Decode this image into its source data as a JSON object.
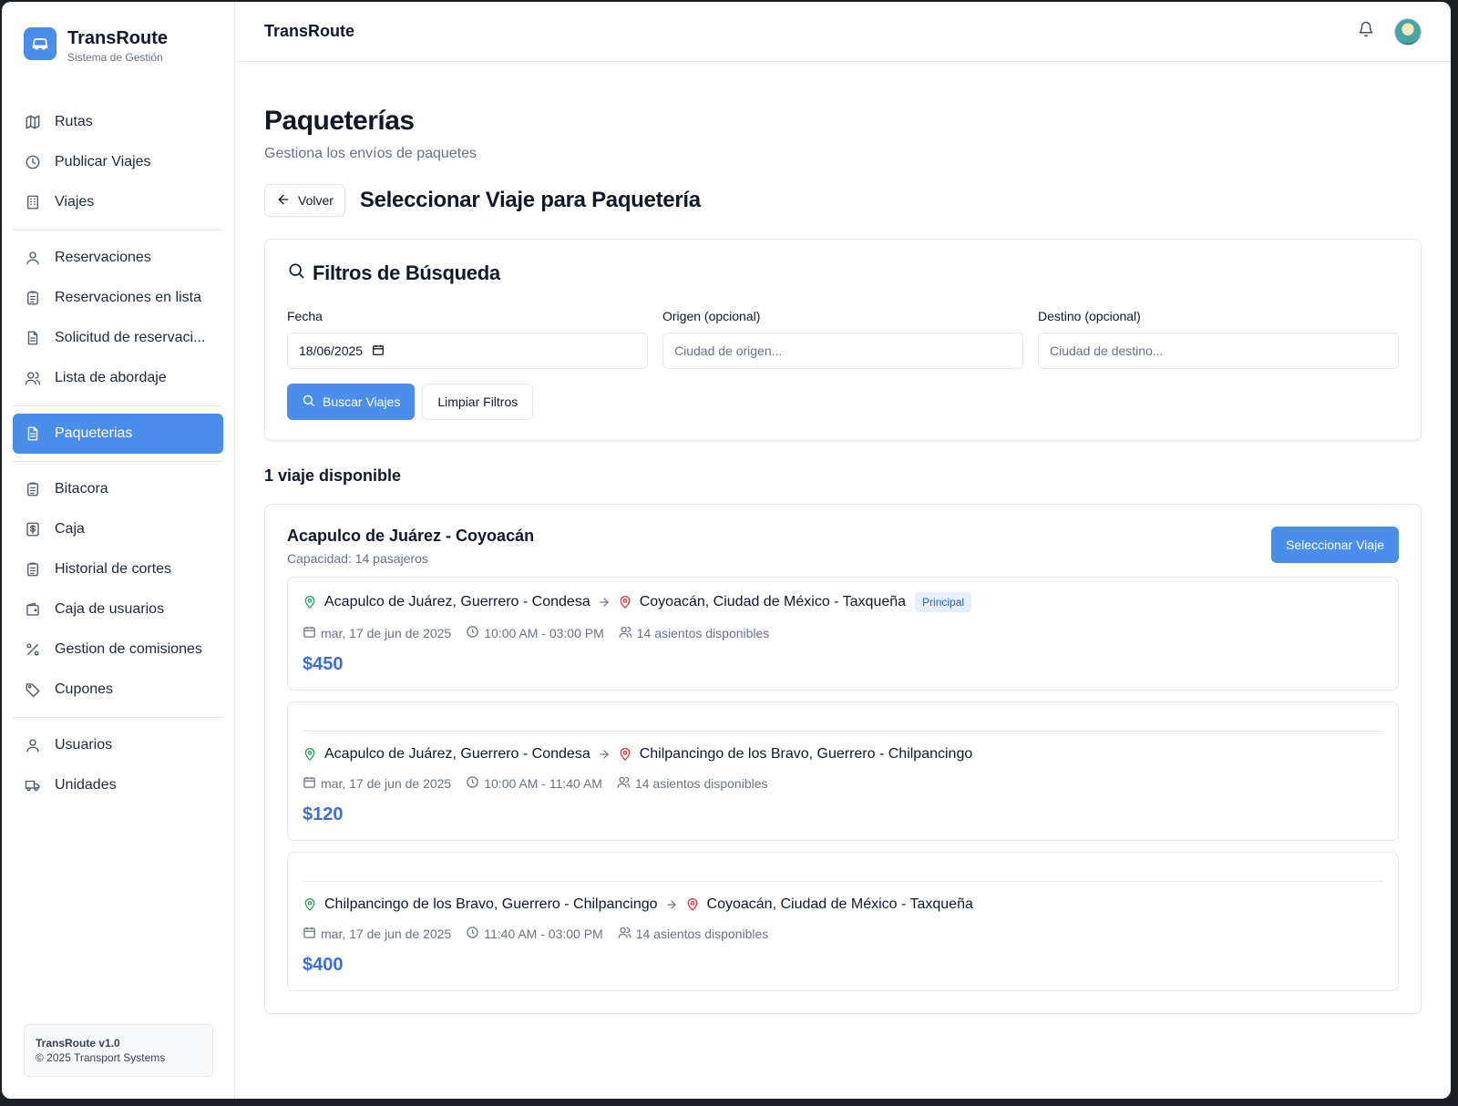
{
  "brand": {
    "name": "TransRoute",
    "subtitle": "Sistema de Gestión"
  },
  "sidebar": {
    "groups": [
      [
        {
          "label": "Rutas",
          "icon": "map-icon"
        },
        {
          "label": "Publicar Viajes",
          "icon": "clock-icon"
        },
        {
          "label": "Viajes",
          "icon": "building-icon"
        }
      ],
      [
        {
          "label": "Reservaciones",
          "icon": "user-icon"
        },
        {
          "label": "Reservaciones en lista",
          "icon": "clipboard-icon"
        },
        {
          "label": "Solicitud de reservaci...",
          "icon": "file-text-icon"
        },
        {
          "label": "Lista de abordaje",
          "icon": "users-icon"
        }
      ],
      [
        {
          "label": "Paqueterias",
          "icon": "file-text-icon",
          "active": true
        }
      ],
      [
        {
          "label": "Bitacora",
          "icon": "clipboard-icon"
        },
        {
          "label": "Caja",
          "icon": "dollar-icon"
        },
        {
          "label": "Historial de cortes",
          "icon": "clipboard-icon"
        },
        {
          "label": "Caja de usuarios",
          "icon": "wallet-icon"
        },
        {
          "label": "Gestion de comisiones",
          "icon": "percent-icon"
        },
        {
          "label": "Cupones",
          "icon": "tag-icon"
        }
      ],
      [
        {
          "label": "Usuarios",
          "icon": "user-icon"
        },
        {
          "label": "Unidades",
          "icon": "truck-icon"
        }
      ]
    ],
    "footer": {
      "version": "TransRoute v1.0",
      "copyright": "© 2025 Transport Systems"
    }
  },
  "topbar": {
    "title": "TransRoute"
  },
  "page": {
    "title": "Paqueterías",
    "subtitle": "Gestiona los envíos de paquetes",
    "back_label": "Volver",
    "section_title": "Seleccionar Viaje para Paquetería"
  },
  "filters": {
    "title": "Filtros de Búsqueda",
    "date_label": "Fecha",
    "date_value": "18/06/2025",
    "origin_label": "Origen (opcional)",
    "origin_placeholder": "Ciudad de origen...",
    "dest_label": "Destino (opcional)",
    "dest_placeholder": "Ciudad de destino...",
    "search_label": "Buscar Viajes",
    "clear_label": "Limpiar Filtros"
  },
  "results": {
    "count_label": "1 viaje disponible",
    "trip": {
      "name": "Acapulco de Juárez - Coyoacán",
      "capacity": "Capacidad: 14 pasajeros",
      "select_label": "Seleccionar Viaje",
      "segments": [
        {
          "origin": "Acapulco de Juárez, Guerrero - Condesa",
          "destination": "Coyoacán, Ciudad de México - Taxqueña",
          "badge": "Principal",
          "date": "mar, 17 de jun de 2025",
          "time": "10:00 AM - 03:00 PM",
          "seats": "14 asientos disponibles",
          "price": "$450"
        },
        {
          "origin": "Acapulco de Juárez, Guerrero - Condesa",
          "destination": "Chilpancingo de los Bravo, Guerrero - Chilpancingo",
          "date": "mar, 17 de jun de 2025",
          "time": "10:00 AM - 11:40 AM",
          "seats": "14 asientos disponibles",
          "price": "$120"
        },
        {
          "origin": "Chilpancingo de los Bravo, Guerrero - Chilpancingo",
          "destination": "Coyoacán, Ciudad de México - Taxqueña",
          "date": "mar, 17 de jun de 2025",
          "time": "11:40 AM - 03:00 PM",
          "seats": "14 asientos disponibles",
          "price": "$400"
        }
      ]
    }
  },
  "colors": {
    "accent": "#4a8eea",
    "price": "#3b6fd8",
    "origin_pin": "#22a35a",
    "dest_pin": "#dc3b3b"
  }
}
